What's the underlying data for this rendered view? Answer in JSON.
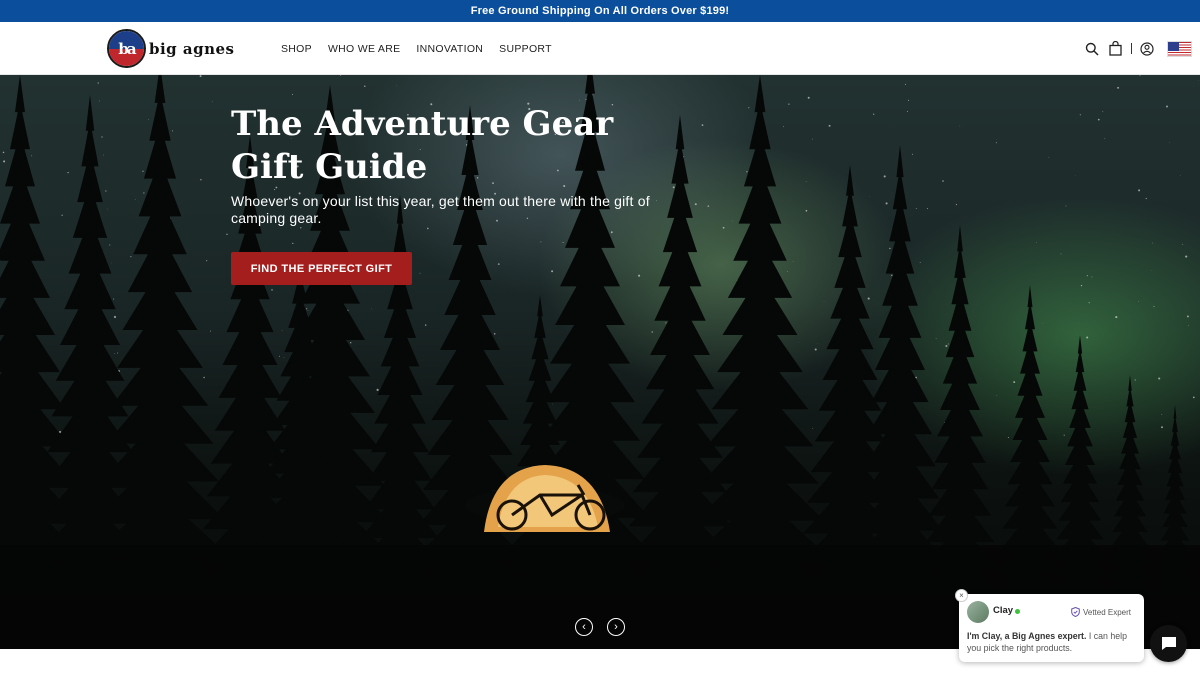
{
  "promo": {
    "text": "Free Ground Shipping On All Orders Over $199!"
  },
  "header": {
    "logo_mark": "ba",
    "logo_text": "big agnes",
    "nav": [
      "SHOP",
      "WHO WE ARE",
      "INNOVATION",
      "SUPPORT"
    ],
    "icons": [
      "search-icon",
      "cart-icon",
      "account-icon",
      "us-flag-icon"
    ]
  },
  "hero": {
    "title": "The Adventure Gear Gift Guide",
    "subtitle": "Whoever's on your list this year, get them out there with the gift of camping gear.",
    "cta_label": "FIND THE PERFECT GIFT",
    "prev_glyph": "‹",
    "next_glyph": "›"
  },
  "chat": {
    "close_glyph": "×",
    "name": "Clay",
    "badge": "Vetted Expert",
    "message_bold": "I'm Clay, a Big Agnes expert.",
    "message_rest": " I can help you pick the right products."
  },
  "colors": {
    "promo_bg": "#0b4f9c",
    "cta_bg": "#a41e1e",
    "online": "#3ac43a"
  }
}
